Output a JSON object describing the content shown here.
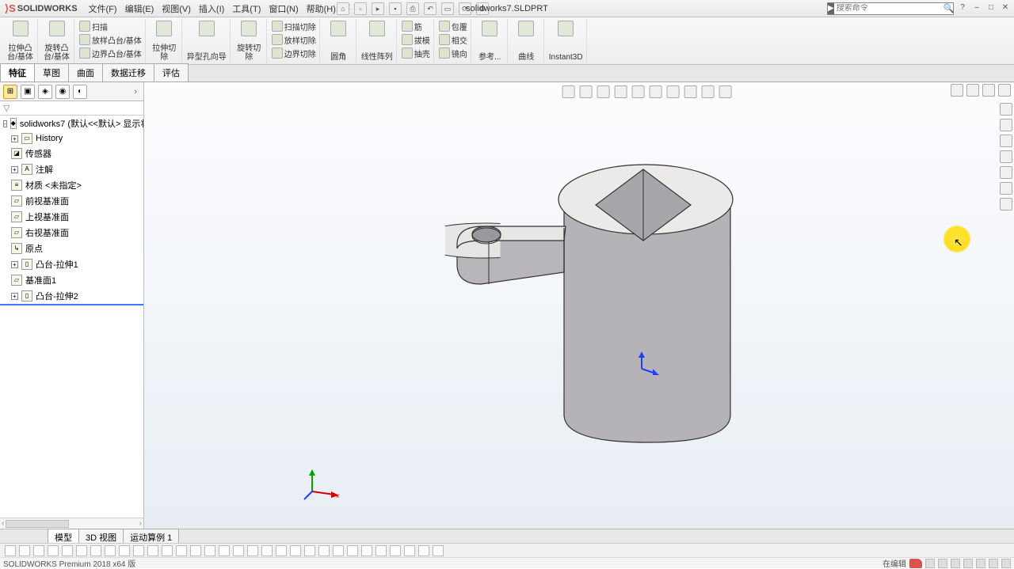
{
  "app": {
    "name": "SOLIDWORKS",
    "doc_title": "solidworks7.SLDPRT"
  },
  "menu": {
    "file": "文件(F)",
    "edit": "编辑(E)",
    "view": "视图(V)",
    "insert": "插入(I)",
    "tools": "工具(T)",
    "window": "窗口(N)",
    "help": "帮助(H)",
    "pin": "✕"
  },
  "search": {
    "placeholder": "搜索命令"
  },
  "ribbon": {
    "g1": {
      "l1": "拉伸凸",
      "l2": "台/基体"
    },
    "g2": {
      "l1": "旋转凸",
      "l2": "台/基体"
    },
    "g3a": "扫描",
    "g3b": "放样凸台/基体",
    "g3c": "边界凸台/基体",
    "g4": {
      "l1": "拉伸切",
      "l2": "除"
    },
    "g5": "异型孔向导",
    "g6": {
      "l1": "旋转切",
      "l2": "除"
    },
    "g6a": "扫描切除",
    "g6b": "放样切除",
    "g6c": "边界切除",
    "g7": "圆角",
    "g8": "线性阵列",
    "g9a": "筋",
    "g9b": "拔模",
    "g9c": "抽壳",
    "g10a": "包覆",
    "g10b": "相交",
    "g10c": "镜向",
    "g11": "参考...",
    "g12": "曲线",
    "g13": "Instant3D"
  },
  "tabs": {
    "features": "特征",
    "sketch": "草图",
    "surfaces": "曲面",
    "dimxpert": "数据迁移",
    "evaluate": "评估"
  },
  "tree": {
    "root": "solidworks7 (默认<<默认> 显示状",
    "history": "History",
    "sensors": "传感器",
    "annotations": "注解",
    "material": "材质 <未指定>",
    "front": "前视基准面",
    "top": "上视基准面",
    "right": "右视基准面",
    "origin": "原点",
    "ext1": "凸台-拉伸1",
    "plane1": "基准面1",
    "ext2": "凸台-拉伸2"
  },
  "bottom_tabs": {
    "model": "模型",
    "view3d": "3D 视图",
    "motion": "运动算例 1"
  },
  "status": {
    "left": "SOLIDWORKS Premium 2018 x64 版",
    "right": "在编辑"
  }
}
